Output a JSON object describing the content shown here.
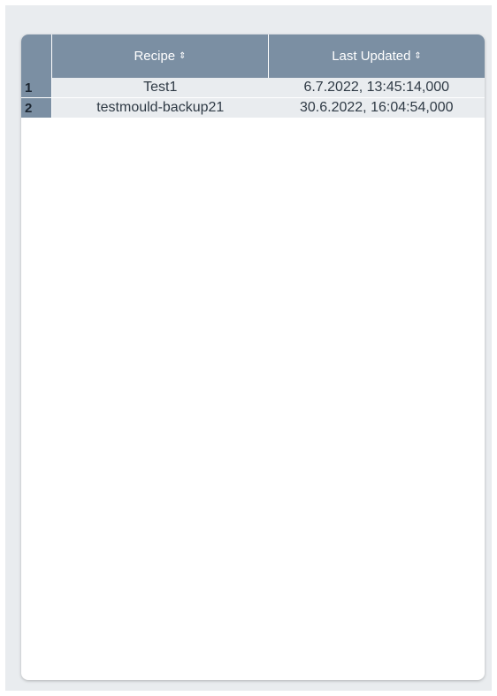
{
  "table": {
    "columns": [
      {
        "label": "Recipe",
        "sort_icon": "sort-icon"
      },
      {
        "label": "Last Updated",
        "sort_icon": "sort-icon"
      }
    ],
    "sort_glyph": "⇕",
    "rows": [
      {
        "index": "1",
        "recipe": "Test1",
        "last_updated": "6.7.2022, 13:45:14,000"
      },
      {
        "index": "2",
        "recipe": "testmould-backup21",
        "last_updated": "30.6.2022, 16:04:54,000"
      }
    ]
  },
  "colors": {
    "header_bg": "#7b8fa3",
    "row_bg": "#e9ecef",
    "background": "#e9ecef"
  }
}
